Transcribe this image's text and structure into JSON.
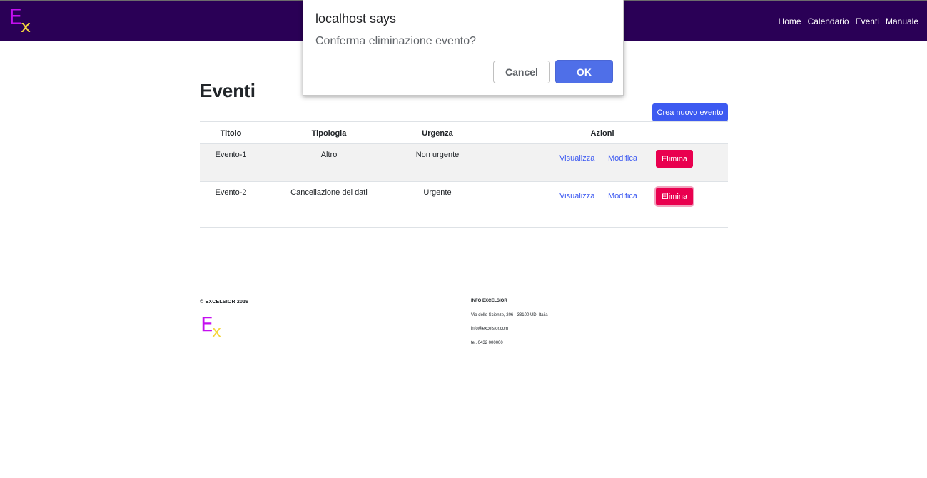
{
  "navbar": {
    "logo_e": "E",
    "logo_x": "x",
    "links": [
      "Home",
      "Calendario",
      "Eventi",
      "Manuale"
    ]
  },
  "main": {
    "title": "Eventi",
    "create_button": "Crea nuovo evento",
    "table": {
      "headers": [
        "Titolo",
        "Tipologia",
        "Urgenza",
        "Azioni"
      ],
      "rows": [
        {
          "titolo": "Evento-1",
          "tipologia": "Altro",
          "urgenza": "Non urgente",
          "visualizza": "Visualizza",
          "modifica": "Modifica",
          "elimina": "Elimina"
        },
        {
          "titolo": "Evento-2",
          "tipologia": "Cancellazione dei dati",
          "urgenza": "Urgente",
          "visualizza": "Visualizza",
          "modifica": "Modifica",
          "elimina": "Elimina"
        }
      ]
    }
  },
  "footer": {
    "copyright": "© EXCELSIOR 2019",
    "logo_e": "E",
    "logo_x": "x",
    "info_title": "INFO EXCELSIOR",
    "address": "Via delle Scienze, 206 - 33100 UD, Italia",
    "email": "info@excelsior.com",
    "phone": "tel. 0432 000000"
  },
  "dialog": {
    "title": "localhost says",
    "message": "Conferma eliminazione evento?",
    "cancel_label": "Cancel",
    "ok_label": "OK"
  },
  "colors": {
    "navbar_bg": "#2a0056",
    "logo_e": "#c40ff0",
    "logo_x": "#f5d63d",
    "primary": "#3d5af1",
    "danger": "#e9004f",
    "dialog_ok": "#4f6fe8"
  }
}
